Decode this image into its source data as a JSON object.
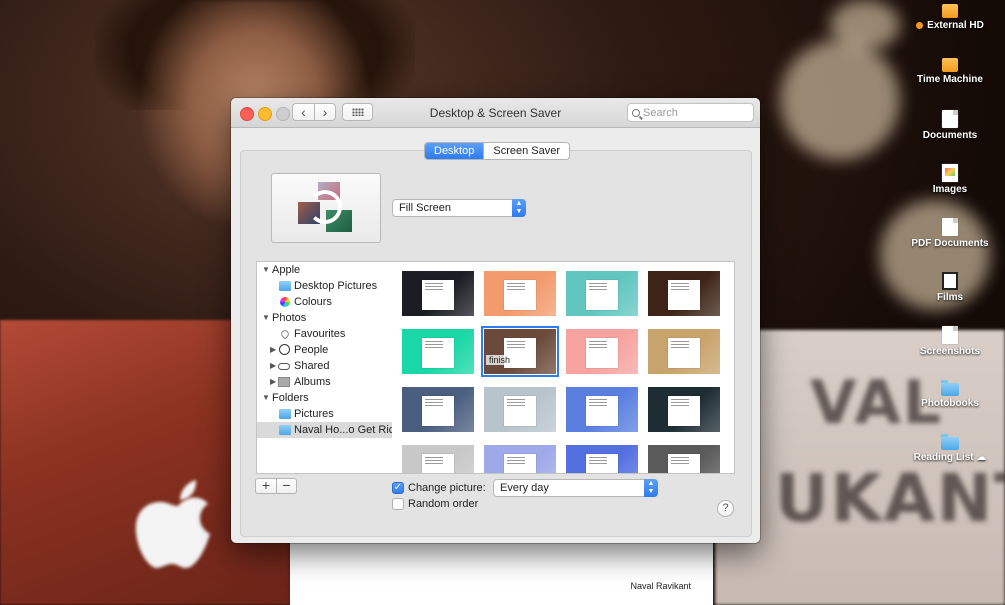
{
  "window": {
    "title": "Desktop & Screen Saver",
    "search_placeholder": "Search",
    "tabs": [
      {
        "label": "Desktop",
        "active": true
      },
      {
        "label": "Screen Saver",
        "active": false
      }
    ],
    "fit_mode": "Fill Screen",
    "sidebar": {
      "sections": [
        {
          "label": "Apple",
          "items": [
            "Desktop Pictures",
            "Colours"
          ]
        },
        {
          "label": "Photos",
          "items": [
            "Favourites",
            "People",
            "Shared",
            "Albums"
          ]
        },
        {
          "label": "Folders",
          "items": [
            "Pictures",
            "Naval Ho...o Get Rich"
          ]
        }
      ]
    },
    "thumbnails": {
      "selected_tooltip": "finish",
      "colors": [
        [
          "#1c1c24",
          "#f39b6d",
          "#62c6c0",
          "#3e2417"
        ],
        [
          "#19d7a6",
          "#6a4a3a",
          "#f7a3a0",
          "#c9a36c"
        ],
        [
          "#4a5e80",
          "#b8c4cc",
          "#5a7fe0",
          "#1e2c34"
        ],
        [
          "#c8c8c8",
          "#9fa8e8",
          "#5470e0",
          "#5a5a5a"
        ]
      ]
    },
    "change_picture_label": "Change picture:",
    "change_picture_checked": true,
    "interval": "Every day",
    "random_order_label": "Random order",
    "random_order_checked": false,
    "add_label": "+",
    "remove_label": "−",
    "help_label": "?"
  },
  "desktop_icons": [
    {
      "label": "External HD",
      "icon": "drive-icon"
    },
    {
      "label": "Time Machine",
      "icon": "drive-icon"
    },
    {
      "label": "Documents",
      "icon": "document-icon"
    },
    {
      "label": "Images",
      "icon": "image-icon"
    },
    {
      "label": "PDF Documents",
      "icon": "document-icon"
    },
    {
      "label": "Films",
      "icon": "film-icon"
    },
    {
      "label": "Screenshots",
      "icon": "document-icon"
    },
    {
      "label": "Photobooks",
      "icon": "folder-icon"
    },
    {
      "label": "Reading List",
      "icon": "folder-icon"
    }
  ],
  "background": {
    "mug_text_1": "VAL",
    "mug_text_2": "UKANT",
    "document_author": "Naval Ravikant"
  }
}
